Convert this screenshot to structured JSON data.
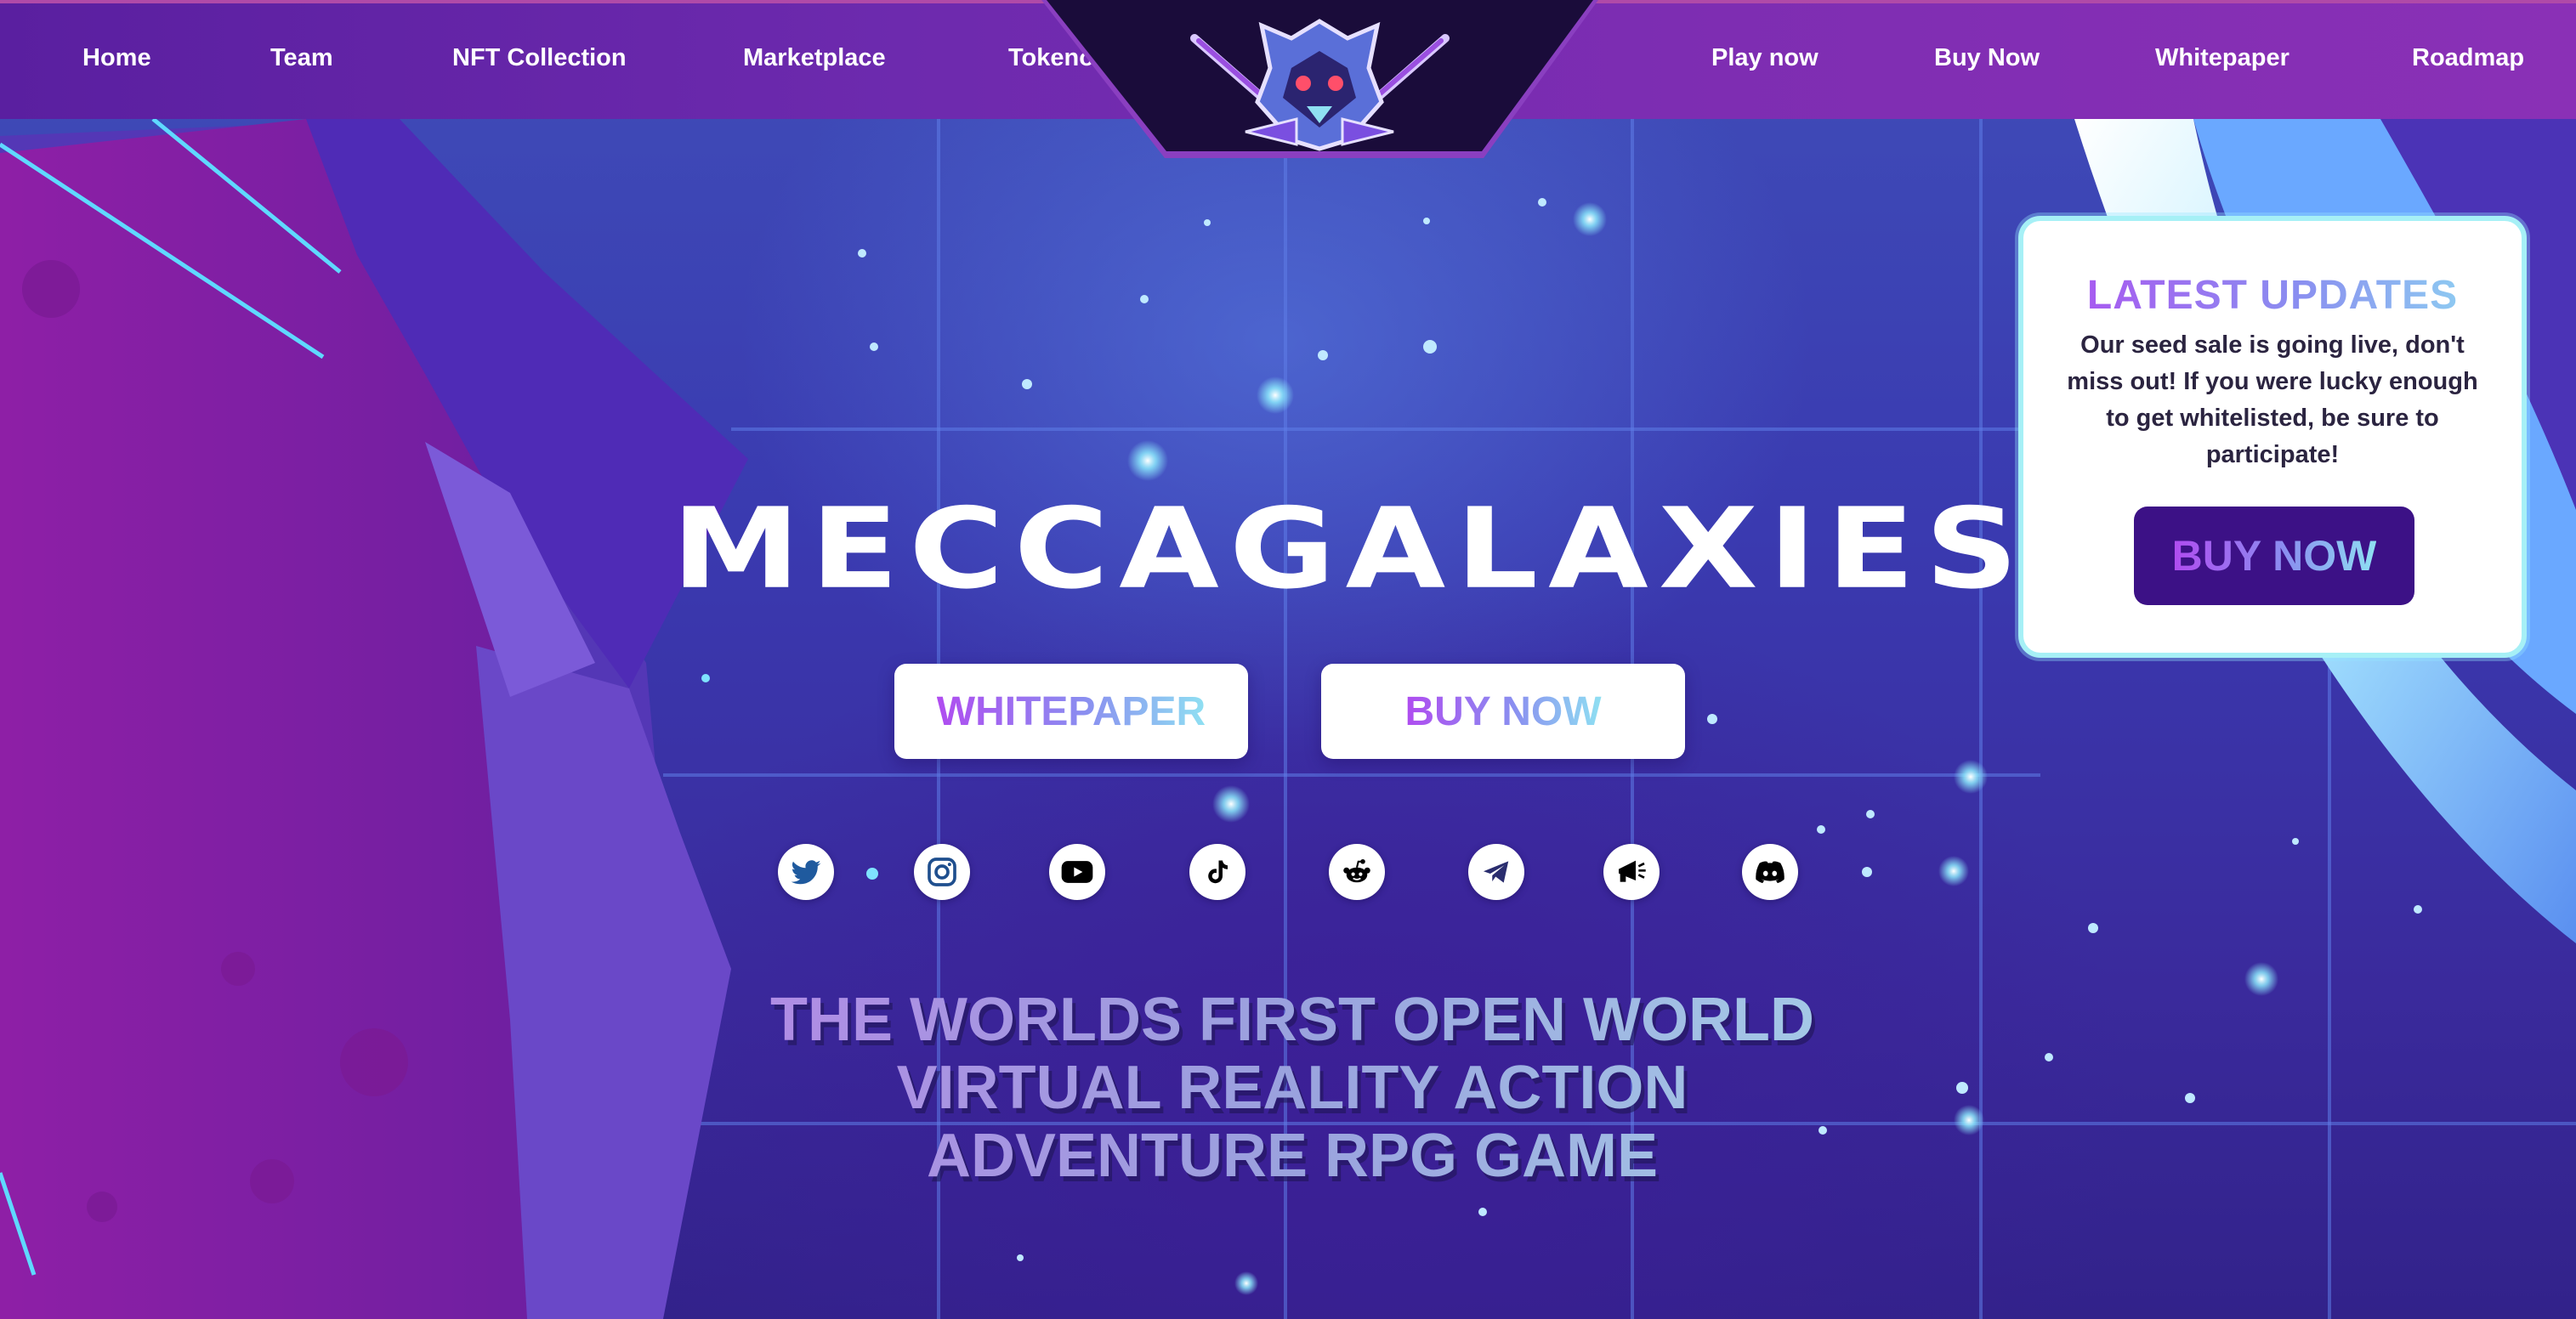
{
  "nav": {
    "items": [
      "Home",
      "Team",
      "NFT Collection",
      "Marketplace",
      "Tokenomics",
      "Play now",
      "Buy Now",
      "Whitepaper",
      "Roadmap"
    ]
  },
  "hero": {
    "title": "MECCAGALAXIES",
    "whitepaper_label": "WHITEPAPER",
    "buy_label": "BUY NOW",
    "tagline_lines": [
      "THE WORLDS FIRST OPEN WORLD",
      "VIRTUAL REALITY ACTION",
      "ADVENTURE RPG GAME"
    ]
  },
  "socials": [
    "twitter-icon",
    "instagram-icon",
    "youtube-icon",
    "tiktok-icon",
    "reddit-icon",
    "telegram-icon",
    "announcement-icon",
    "discord-icon"
  ],
  "updates": {
    "title": "LATEST UPDATES",
    "body": "Our seed sale is going live, don't miss out! If you were lucky enough to get whitelisted, be sure to participate!",
    "button_label": "BUY NOW"
  },
  "colors": {
    "nav_bg": "#6d2aae",
    "accent_purple": "#b04cf0",
    "accent_cyan": "#8fe0f2",
    "updates_button": "#3c1186",
    "updates_border": "#a6f0f6"
  }
}
